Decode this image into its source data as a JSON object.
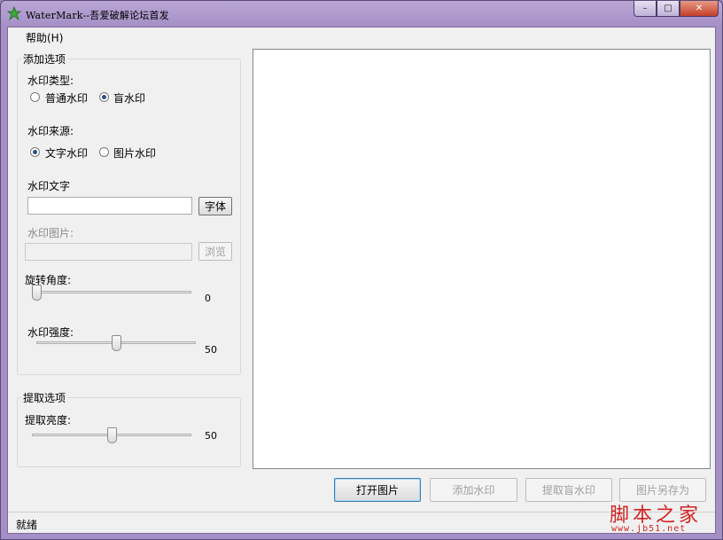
{
  "window": {
    "title": "WaterMark--吾爱破解论坛首发",
    "minimize_glyph": "–",
    "maximize_glyph": "□",
    "close_glyph": "✕",
    "accent": "#a48fc6"
  },
  "menu": {
    "help": "帮助(H)"
  },
  "add_options": {
    "title": "添加选项",
    "type_label": "水印类型:",
    "type_options": [
      {
        "label": "普通水印",
        "checked": false
      },
      {
        "label": "盲水印",
        "checked": true
      }
    ],
    "source_label": "水印来源:",
    "source_options": [
      {
        "label": "文字水印",
        "checked": true
      },
      {
        "label": "图片水印",
        "checked": false
      }
    ],
    "text_label": "水印文字",
    "text_value": "",
    "font_button": "字体",
    "image_label": "水印图片:",
    "image_value": "",
    "browse_button": "浏览",
    "rotation_label": "旋转角度:",
    "rotation_value": "0",
    "rotation_fraction": 0.0,
    "strength_label": "水印强度:",
    "strength_value": "50",
    "strength_fraction": 0.5
  },
  "extract_options": {
    "title": "提取选项",
    "brightness_label": "提取亮度:",
    "brightness_value": "50",
    "brightness_fraction": 0.5
  },
  "actions": {
    "open": "打开图片",
    "add_watermark": "添加水印",
    "extract": "提取盲水印",
    "save_as": "图片另存为"
  },
  "status": {
    "text": "就绪"
  },
  "site_watermark": {
    "text": "脚本之家",
    "url": "www.jb51.net"
  }
}
